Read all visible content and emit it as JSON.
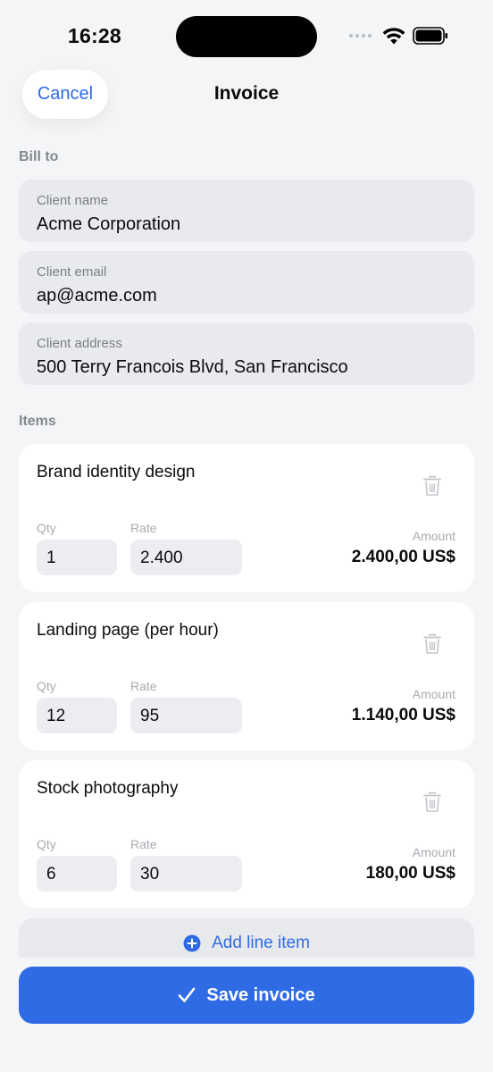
{
  "status_bar": {
    "time": "16:28"
  },
  "header": {
    "cancel_label": "Cancel",
    "title": "Invoice"
  },
  "bill_to": {
    "section_label": "Bill to",
    "fields": [
      {
        "label": "Client name",
        "value": "Acme Corporation"
      },
      {
        "label": "Client email",
        "value": "ap@acme.com"
      },
      {
        "label": "Client address",
        "value": "500 Terry Francois Blvd, San Francisco"
      }
    ]
  },
  "items": {
    "section_label": "Items",
    "qty_label": "Qty",
    "rate_label": "Rate",
    "amount_label": "Amount",
    "list": [
      {
        "title": "Brand identity design",
        "qty": "1",
        "rate": "2.400",
        "amount": "2.400,00 US$"
      },
      {
        "title": "Landing page (per hour)",
        "qty": "12",
        "rate": "95",
        "amount": "1.140,00 US$"
      },
      {
        "title": "Stock photography",
        "qty": "6",
        "rate": "30",
        "amount": "180,00 US$"
      }
    ],
    "add_label": "Add line item"
  },
  "footer": {
    "save_label": "Save invoice"
  },
  "colors": {
    "accent": "#2e6be4",
    "background": "#f4f5f7",
    "field": "#e9eaee"
  },
  "icons": [
    "wifi-icon",
    "battery-icon",
    "trash-icon",
    "plus-circle-icon",
    "checkmark-icon"
  ]
}
